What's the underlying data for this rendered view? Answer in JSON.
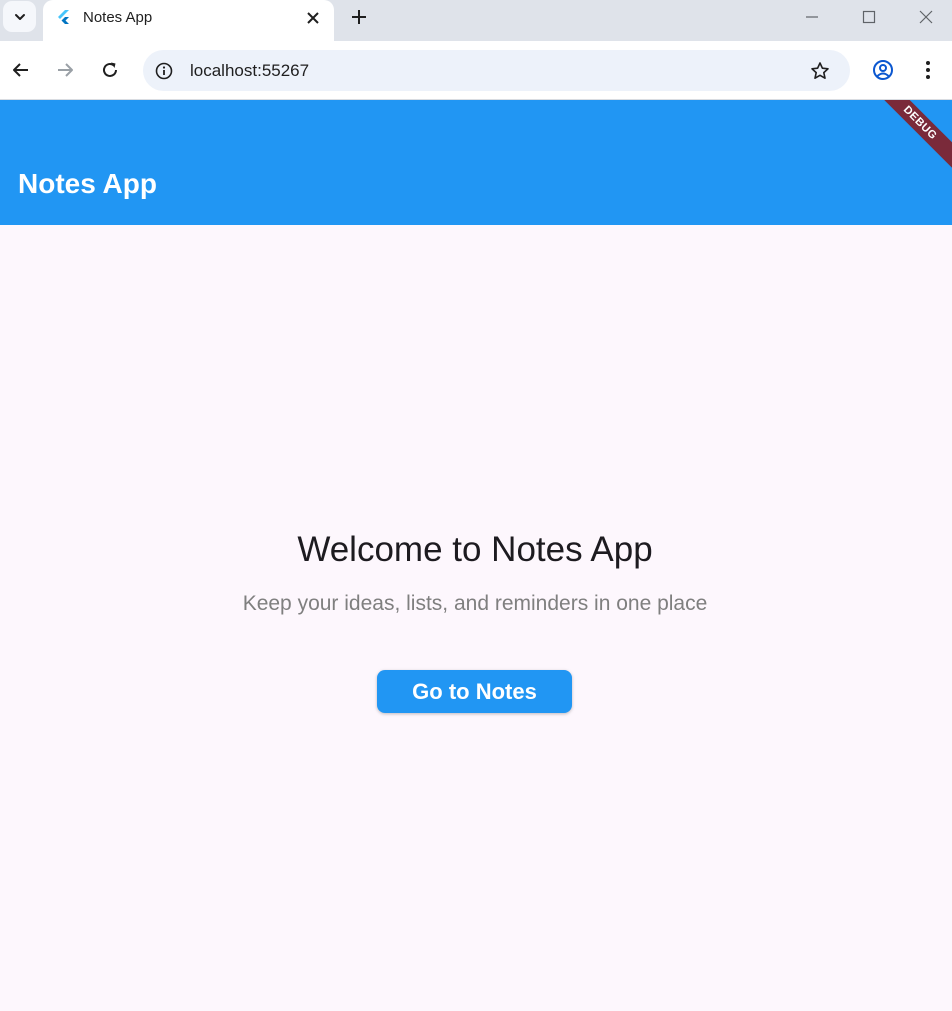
{
  "browser": {
    "tab_title": "Notes App",
    "url": "localhost:55267",
    "icons": {
      "tab_search": "chevron-down-icon",
      "favicon": "flutter-icon",
      "tab_close": "close-icon",
      "new_tab": "plus-icon",
      "back": "arrow-left-icon",
      "forward": "arrow-right-icon",
      "reload": "reload-icon",
      "site_info": "info-icon",
      "bookmark": "star-icon",
      "profile": "account-circle-icon",
      "menu": "more-vert-icon",
      "minimize": "minimize-icon",
      "maximize": "maximize-icon",
      "close_window": "close-icon"
    }
  },
  "app": {
    "title": "Notes App",
    "debug_label": "DEBUG",
    "welcome_heading": "Welcome to Notes App",
    "subtitle": "Keep your ideas, lists, and reminders in one place",
    "go_button_label": "Go to Notes"
  },
  "colors": {
    "app_bar": "#2196f3",
    "button": "#2196f3",
    "background": "#fdf7fd",
    "debug_banner": "#7a2a3a"
  }
}
